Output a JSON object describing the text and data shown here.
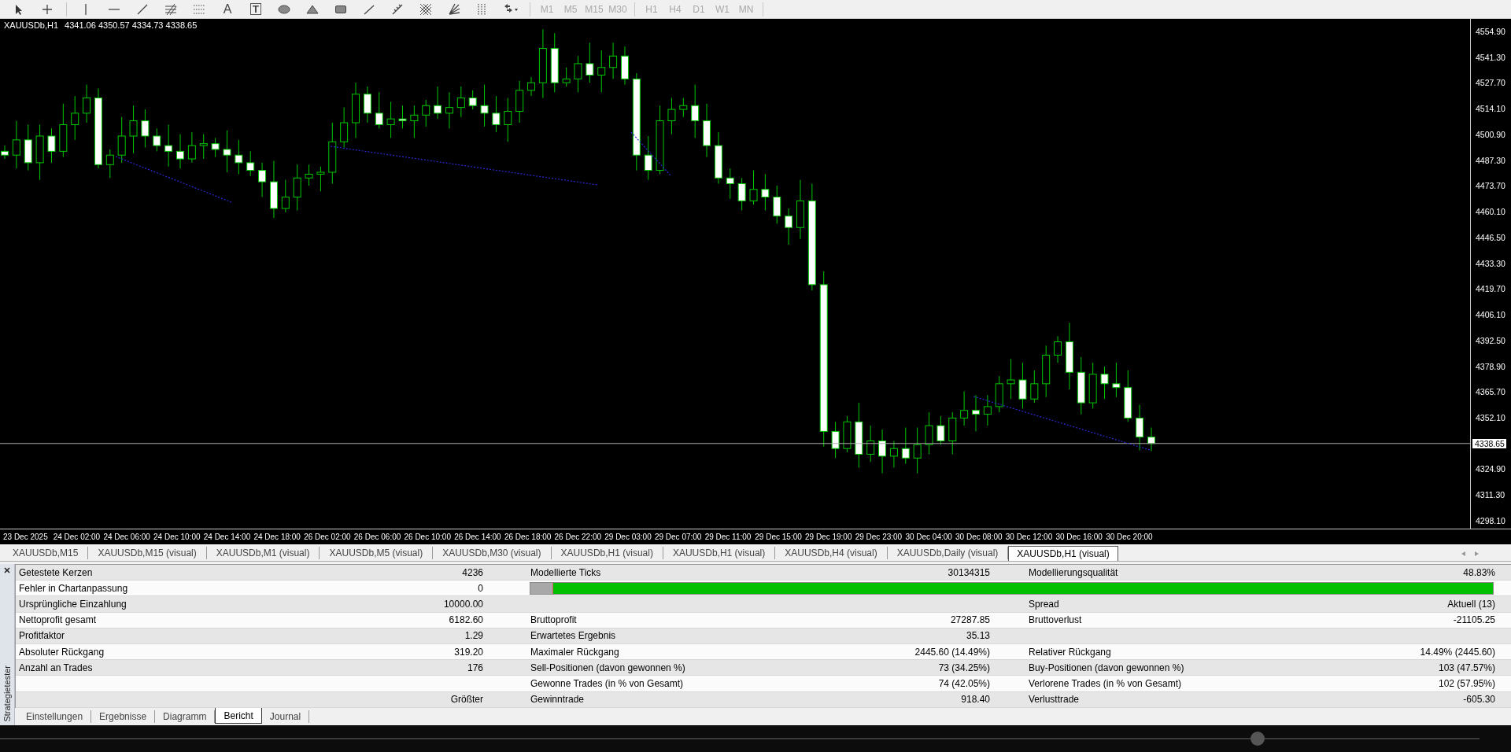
{
  "toolbar": {
    "text_tool": "A",
    "label_tool": "T",
    "timeframes": [
      {
        "label": "M1",
        "disabled": true
      },
      {
        "label": "M5",
        "disabled": true
      },
      {
        "label": "M15",
        "disabled": true
      },
      {
        "label": "M30",
        "disabled": true
      },
      {
        "label": "H1",
        "disabled": true
      },
      {
        "label": "H4",
        "disabled": true
      },
      {
        "label": "D1",
        "disabled": true
      },
      {
        "label": "W1",
        "disabled": true
      },
      {
        "label": "MN",
        "disabled": true
      }
    ]
  },
  "chart": {
    "symbol": "XAUUSDb,H1",
    "ohlc": "4341.06 4350.57 4334.73 4338.65",
    "price_labels": [
      {
        "text": "4554.90",
        "current": false
      },
      {
        "text": "4541.30",
        "current": false
      },
      {
        "text": "4527.70",
        "current": false
      },
      {
        "text": "4514.10",
        "current": false
      },
      {
        "text": "4500.90",
        "current": false
      },
      {
        "text": "4487.30",
        "current": false
      },
      {
        "text": "4473.70",
        "current": false
      },
      {
        "text": "4460.10",
        "current": false
      },
      {
        "text": "4446.50",
        "current": false
      },
      {
        "text": "4433.30",
        "current": false
      },
      {
        "text": "4419.70",
        "current": false
      },
      {
        "text": "4406.10",
        "current": false
      },
      {
        "text": "4392.50",
        "current": false
      },
      {
        "text": "4378.90",
        "current": false
      },
      {
        "text": "4365.70",
        "current": false
      },
      {
        "text": "4352.10",
        "current": false
      },
      {
        "text": "4338.65",
        "current": true
      },
      {
        "text": "4324.90",
        "current": false
      },
      {
        "text": "4311.30",
        "current": false
      },
      {
        "text": "4298.10",
        "current": false
      }
    ],
    "time_labels": [
      "23 Dec 2025",
      "24 Dec 02:00",
      "24 Dec 06:00",
      "24 Dec 10:00",
      "24 Dec 14:00",
      "24 Dec 18:00",
      "26 Dec 02:00",
      "26 Dec 06:00",
      "26 Dec 10:00",
      "26 Dec 14:00",
      "26 Dec 18:00",
      "26 Dec 22:00",
      "29 Dec 03:00",
      "29 Dec 07:00",
      "29 Dec 11:00",
      "29 Dec 15:00",
      "29 Dec 19:00",
      "29 Dec 23:00",
      "30 Dec 04:00",
      "30 Dec 08:00",
      "30 Dec 12:00",
      "30 Dec 16:00",
      "30 Dec 20:00"
    ]
  },
  "chart_tabs": [
    {
      "label": "XAUUSDb,M15",
      "selected": false
    },
    {
      "label": "XAUUSDb,M15 (visual)",
      "selected": false
    },
    {
      "label": "XAUUSDb,M1 (visual)",
      "selected": false
    },
    {
      "label": "XAUUSDb,M5 (visual)",
      "selected": false
    },
    {
      "label": "XAUUSDb,M30 (visual)",
      "selected": false
    },
    {
      "label": "XAUUSDb,H1 (visual)",
      "selected": false
    },
    {
      "label": "XAUUSDb,H1 (visual)",
      "selected": false
    },
    {
      "label": "XAUUSDb,H4 (visual)",
      "selected": false
    },
    {
      "label": "XAUUSDb,Daily (visual)",
      "selected": false
    },
    {
      "label": "XAUUSDb,H1 (visual)",
      "selected": true
    }
  ],
  "report": {
    "rows": [
      {
        "label_1": "Getestete Kerzen",
        "value_1": "4236",
        "label_2": "Modellierte Ticks",
        "value_2": "30134315",
        "label_3": "Modellierungsqualität",
        "value_3": "48.83%"
      },
      {
        "label_1": "Fehler in Chartanpassung",
        "value_1": "0",
        "quality_bar": {
          "level": 0.976
        }
      },
      {
        "label_1": "Ursprüngliche Einzahlung",
        "value_1": "10000.00",
        "label_3": "Spread",
        "value_3": "Aktuell (13)"
      },
      {
        "label_1": "Nettoprofit gesamt",
        "value_1": "6182.60",
        "label_2": "Bruttoprofit",
        "value_2": "27287.85",
        "label_3": "Bruttoverlust",
        "value_3": "-21105.25"
      },
      {
        "label_1": "Profitfaktor",
        "value_1": "1.29",
        "label_2": "Erwartetes Ergebnis",
        "value_2": "35.13"
      },
      {
        "label_1": "Absoluter Rückgang",
        "value_1": "319.20",
        "label_2": "Maximaler Rückgang",
        "value_2": "2445.60 (14.49%)",
        "label_3": "Relativer Rückgang",
        "value_3": "14.49% (2445.60)"
      },
      {
        "label_1": "Anzahl an Trades",
        "value_1": "176",
        "label_2": "Sell-Positionen (davon gewonnen %)",
        "value_2": "73 (34.25%)",
        "label_3": "Buy-Positionen (davon gewonnen %)",
        "value_3": "103 (47.57%)"
      },
      {
        "label_2": "Gewonne Trades (in % von Gesamt)",
        "value_2": "74 (42.05%)",
        "label_3": "Verlorene Trades (in % von Gesamt)",
        "value_3": "102 (57.95%)"
      },
      {
        "value_1": "Größter",
        "label_2": "Gewinntrade",
        "value_2": "918.40",
        "label_3": "Verlusttrade",
        "value_3": "-605.30"
      }
    ]
  },
  "side_panel": {
    "title": "Strategietester"
  },
  "bottom_tabs": [
    {
      "label": "Einstellungen",
      "selected": false
    },
    {
      "label": "Ergebnisse",
      "selected": false
    },
    {
      "label": "Diagramm",
      "selected": false
    },
    {
      "label": "Bericht",
      "selected": true
    },
    {
      "label": "Journal",
      "selected": false
    }
  ],
  "playback_bar": {
    "level": 0.85
  }
}
